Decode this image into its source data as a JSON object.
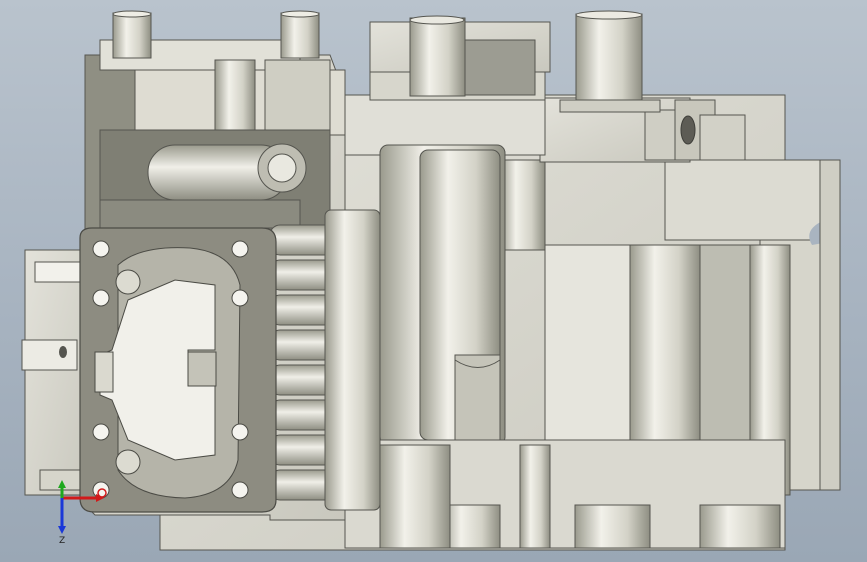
{
  "viewport": {
    "background_top": "#b9c3cd",
    "background_bottom": "#9aa7b5",
    "model_color": "#d9d8cf",
    "shadow_color": "#8c8c80"
  },
  "triad": {
    "x_label": "",
    "y_label": "",
    "z_label": "Z",
    "x_color": "#d11a1a",
    "y_color": "#1ea81e",
    "z_color": "#1a38d8"
  }
}
